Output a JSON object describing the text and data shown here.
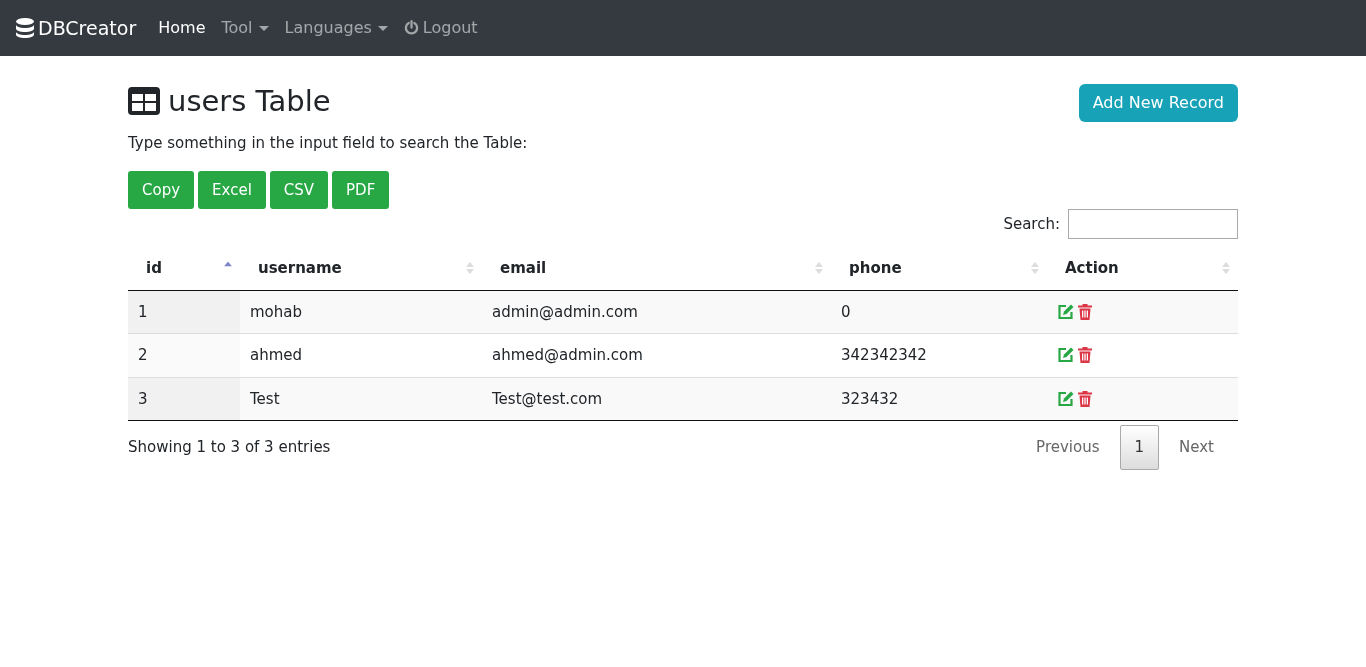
{
  "navbar": {
    "brand": "DBCreator",
    "items": [
      {
        "label": "Home",
        "kind": "link",
        "selected": true
      },
      {
        "label": "Tool",
        "kind": "dropdown",
        "selected": false
      },
      {
        "label": "Languages",
        "kind": "dropdown",
        "selected": false
      },
      {
        "label": "Logout",
        "kind": "logout",
        "selected": false
      }
    ]
  },
  "page": {
    "title": "users Table",
    "add_button": "Add New Record",
    "hint": "Type something in the input field to search the Table:",
    "export_buttons": [
      "Copy",
      "Excel",
      "CSV",
      "PDF"
    ],
    "search_label": "Search:"
  },
  "table": {
    "columns": [
      {
        "label": "id",
        "sorted": true
      },
      {
        "label": "username",
        "sorted": false
      },
      {
        "label": "email",
        "sorted": false
      },
      {
        "label": "phone",
        "sorted": false
      },
      {
        "label": "Action",
        "sorted": false
      }
    ],
    "rows": [
      [
        "1",
        "mohab",
        "admin@admin.com",
        "0"
      ],
      [
        "2",
        "ahmed",
        "ahmed@admin.com",
        "342342342"
      ],
      [
        "3",
        "Test",
        "Test@test.com",
        "323432"
      ]
    ]
  },
  "footer": {
    "info": "Showing 1 to 3 of 3 entries",
    "previous": "Previous",
    "pages": [
      {
        "label": "1",
        "selected": true
      }
    ],
    "next": "Next"
  }
}
